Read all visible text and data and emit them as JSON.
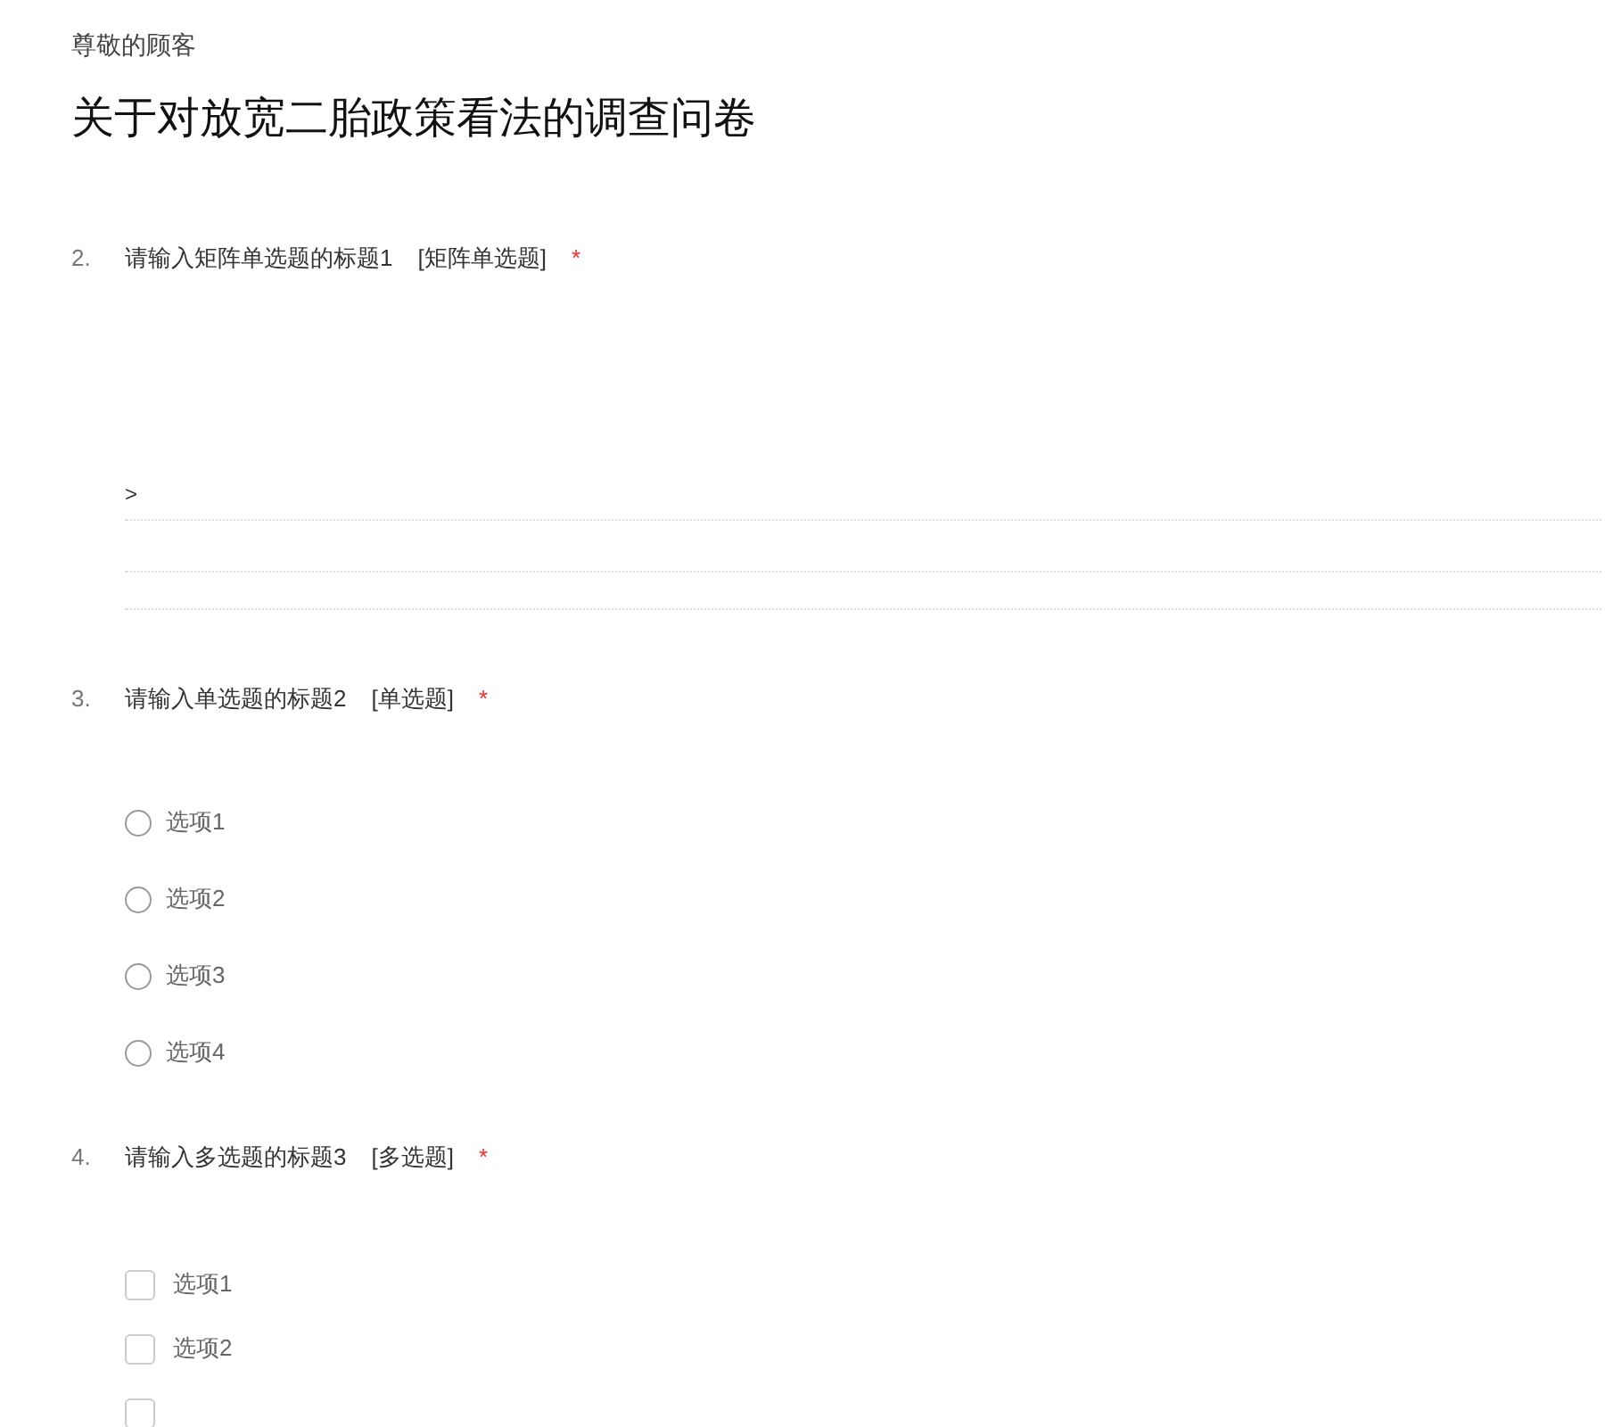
{
  "greeting": "尊敬的顾客",
  "title": "关于对放宽二胎政策看法的调查问卷",
  "questions": [
    {
      "number": "2.",
      "title": "请输入矩阵单选题的标题1",
      "type_label": "[矩阵单选题]",
      "required": true,
      "required_mark": "*",
      "kind": "matrix",
      "rows": [
        {
          "label": ">"
        }
      ]
    },
    {
      "number": "3.",
      "title": "请输入单选题的标题2",
      "type_label": "[单选题]",
      "required": true,
      "required_mark": "*",
      "kind": "radio",
      "options": [
        {
          "label": "选项1",
          "selected": false
        },
        {
          "label": "选项2",
          "selected": false
        },
        {
          "label": "选项3",
          "selected": false
        },
        {
          "label": "选项4",
          "selected": false
        }
      ]
    },
    {
      "number": "4.",
      "title": "请输入多选题的标题3",
      "type_label": "[多选题]",
      "required": true,
      "required_mark": "*",
      "kind": "checkbox",
      "options": [
        {
          "label": "选项1",
          "checked": false
        },
        {
          "label": "选项2",
          "checked": false
        },
        {
          "checked": false
        }
      ]
    }
  ]
}
